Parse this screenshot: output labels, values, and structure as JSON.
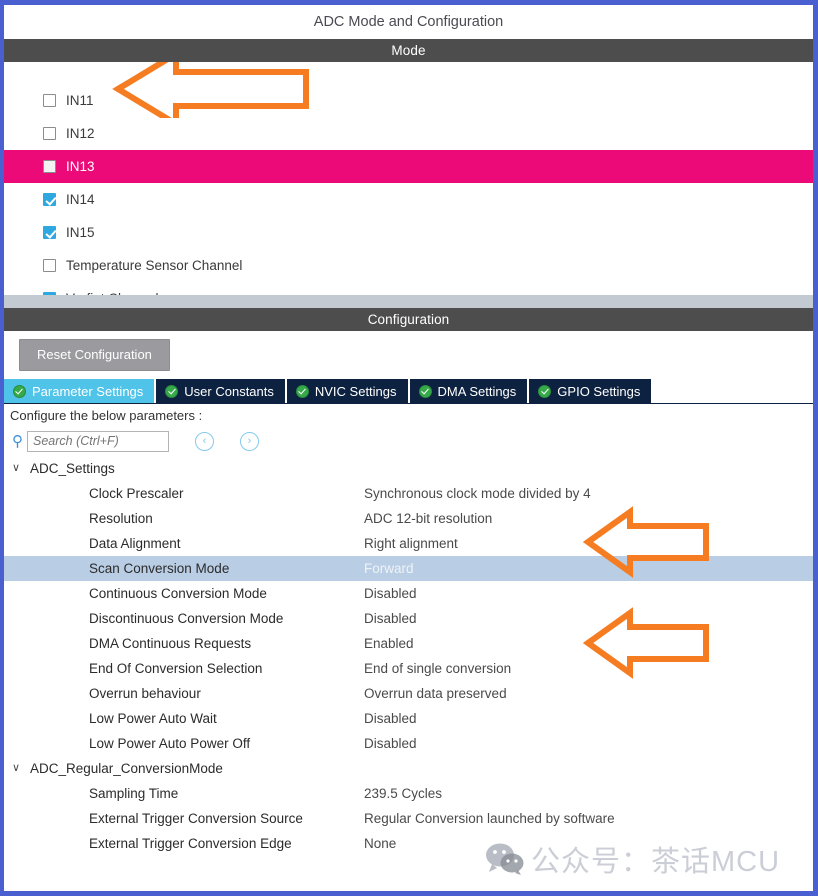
{
  "window": {
    "title": "ADC Mode and Configuration"
  },
  "mode_section": {
    "header": "Mode",
    "channels": [
      {
        "label": "IN11",
        "checked": false,
        "selected": false
      },
      {
        "label": "IN12",
        "checked": false,
        "selected": false
      },
      {
        "label": "IN13",
        "checked": false,
        "selected": true
      },
      {
        "label": "IN14",
        "checked": true,
        "selected": false
      },
      {
        "label": "IN15",
        "checked": true,
        "selected": false
      },
      {
        "label": "Temperature Sensor Channel",
        "checked": false,
        "selected": false
      },
      {
        "label": "Vrefint Channel",
        "checked": true,
        "selected": false
      }
    ]
  },
  "configuration_section": {
    "header": "Configuration",
    "reset_button": "Reset Configuration",
    "tabs": [
      {
        "label": "Parameter Settings",
        "icon": "green-check-icon",
        "active": true
      },
      {
        "label": "User Constants",
        "icon": "green-check-icon",
        "active": false
      },
      {
        "label": "NVIC Settings",
        "icon": "green-check-icon",
        "active": false
      },
      {
        "label": "DMA Settings",
        "icon": "green-check-icon",
        "active": false
      },
      {
        "label": "GPIO Settings",
        "icon": "green-check-icon",
        "active": false
      }
    ],
    "configure_label": "Configure the below parameters :",
    "search": {
      "placeholder": "Search (Ctrl+F)",
      "value": "",
      "icon": "search-icon"
    },
    "nav_back": "‹",
    "nav_forward": "›",
    "groups": [
      {
        "name": "ADC_Settings",
        "expanded": true,
        "chevron": "∨",
        "params": [
          {
            "name": "Clock Prescaler",
            "value": "Synchronous clock mode divided by 4",
            "highlight": false
          },
          {
            "name": "Resolution",
            "value": "ADC 12-bit resolution",
            "highlight": false
          },
          {
            "name": "Data Alignment",
            "value": "Right alignment",
            "highlight": false
          },
          {
            "name": "Scan Conversion Mode",
            "value": "Forward",
            "highlight": true
          },
          {
            "name": "Continuous Conversion Mode",
            "value": "Disabled",
            "highlight": false
          },
          {
            "name": "Discontinuous Conversion Mode",
            "value": "Disabled",
            "highlight": false
          },
          {
            "name": "DMA Continuous Requests",
            "value": "Enabled",
            "highlight": false
          },
          {
            "name": "End Of Conversion Selection",
            "value": "End of single conversion",
            "highlight": false
          },
          {
            "name": "Overrun behaviour",
            "value": "Overrun data preserved",
            "highlight": false
          },
          {
            "name": "Low Power Auto Wait",
            "value": "Disabled",
            "highlight": false
          },
          {
            "name": "Low Power Auto Power Off",
            "value": "Disabled",
            "highlight": false
          }
        ]
      },
      {
        "name": "ADC_Regular_ConversionMode",
        "expanded": true,
        "chevron": "∨",
        "params": [
          {
            "name": "Sampling Time",
            "value": "239.5 Cycles",
            "highlight": false
          },
          {
            "name": "External Trigger Conversion Source",
            "value": "Regular Conversion launched by software",
            "highlight": false
          },
          {
            "name": "External Trigger Conversion Edge",
            "value": "None",
            "highlight": false
          }
        ]
      }
    ]
  },
  "annotations": {
    "arrow_color": "#f57c20",
    "arrows": [
      {
        "name": "arrow-temperature-sensor-channel",
        "direction": "left"
      },
      {
        "name": "arrow-scan-conversion-mode",
        "direction": "left"
      },
      {
        "name": "arrow-dma-continuous-requests",
        "direction": "left"
      }
    ]
  },
  "watermark": {
    "text": "公众号：茶话MCU",
    "logo": "wechat-icon"
  },
  "colors": {
    "window_border": "#4a5fd0",
    "section_bar": "#4d4d4d",
    "selected_row": "#eb0a78",
    "checkbox_checked": "#2fa8e0",
    "tab_active": "#4fc3e8",
    "tab_inactive": "#0d2240",
    "row_highlight": "#b9cde4",
    "arrow": "#f57c20"
  }
}
